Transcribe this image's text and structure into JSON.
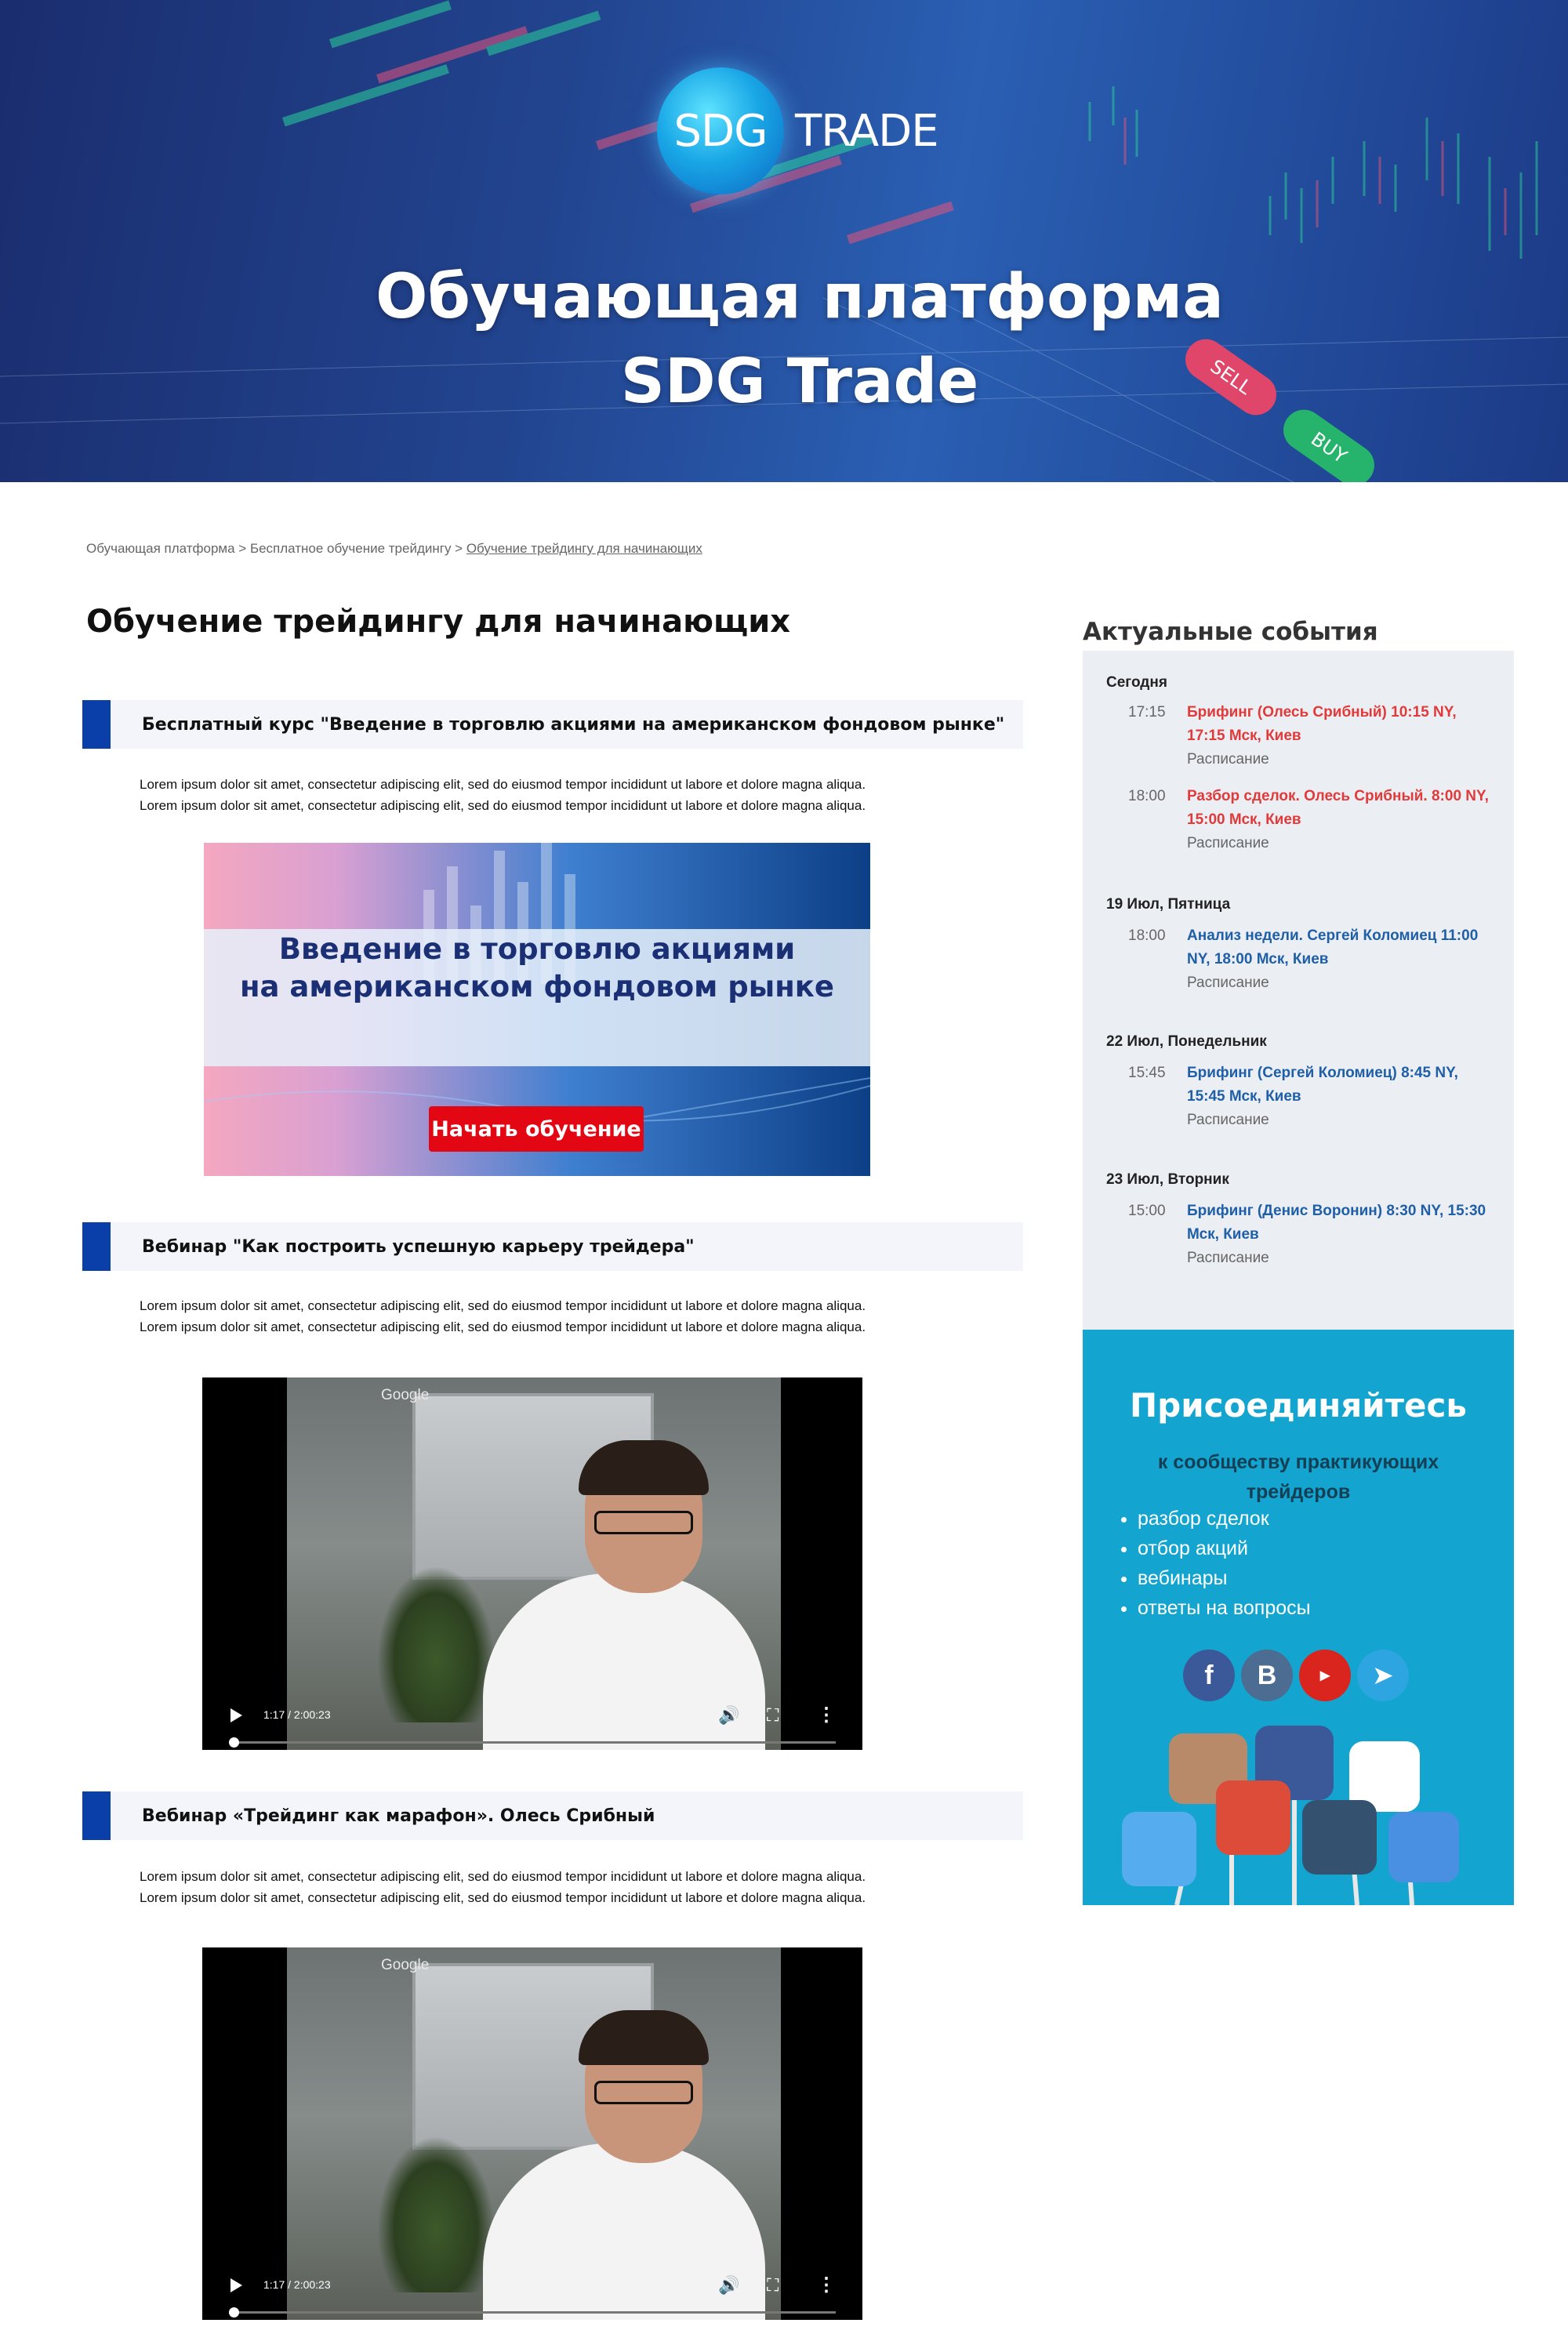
{
  "hero": {
    "logo_sdg": "SDG",
    "logo_trade": "TRADE",
    "title_line1": "Обучающая платформа",
    "title_line2": "SDG Trade",
    "sell_label": "SELL",
    "buy_label": "BUY"
  },
  "breadcrumb": {
    "item1": "Обучающая платформа",
    "sep1": " > ",
    "item2": "Бесплатное обучение трейдингу",
    "sep2": "  > ",
    "item3": "Обучение трейдингу для начинающих"
  },
  "main": {
    "title": "Обучение трейдингу для начинающих",
    "sections": [
      {
        "heading": "Бесплатный курс \"Введение в торговлю акциями на американском фондовом рынке\"",
        "text_line1": "Lorem ipsum dolor sit amet, consectetur adipiscing elit, sed do eiusmod tempor incididunt ut labore et dolore magna aliqua.",
        "text_line2": "Lorem ipsum dolor sit amet, consectetur adipiscing elit, sed do eiusmod tempor incididunt ut labore et dolore magna aliqua."
      },
      {
        "heading": "Вебинар \"Как построить успешную карьеру трейдера\"",
        "text_line1": "Lorem ipsum dolor sit amet, consectetur adipiscing elit, sed do eiusmod tempor incididunt ut labore et dolore magna aliqua.",
        "text_line2": "Lorem ipsum dolor sit amet, consectetur adipiscing elit, sed do eiusmod tempor incididunt ut labore et dolore magna aliqua."
      },
      {
        "heading": "Вебинар «Трейдинг как марафон». Олесь Срибный",
        "text_line1": "Lorem ipsum dolor sit amet, consectetur adipiscing elit, sed do eiusmod tempor incididunt ut labore et dolore magna aliqua.",
        "text_line2": "Lorem ipsum dolor sit amet, consectetur adipiscing elit, sed do eiusmod tempor incididunt ut labore et dolore magna aliqua."
      }
    ],
    "banner": {
      "line1": "Введение в торговлю акциями",
      "line2": "на американском фондовом рынке",
      "button": "Начать обучение"
    },
    "video": {
      "label": "Google",
      "time": "1:17 / 2:00:23"
    }
  },
  "sidebar": {
    "events_title": "Актуальные события",
    "schedule_label": "Расписание",
    "days": [
      {
        "day": "Сегодня",
        "events": [
          {
            "time": "17:15",
            "title": "Брифинг (Олесь Срибный) 10:15 NY, 17:15 Мск, Киев",
            "color": "#e03a3a"
          },
          {
            "time": "18:00",
            "title": "Разбор сделок. Олесь Срибный. 8:00 NY, 15:00 Мск, Киев",
            "color": "#e03a3a"
          }
        ]
      },
      {
        "day": "19 Июл, Пятница",
        "events": [
          {
            "time": "18:00",
            "title": "Анализ недели. Сергей Коломиец 11:00 NY, 18:00 Мск, Киев",
            "color": "#1f5fa8"
          }
        ]
      },
      {
        "day": "22 Июл, Понедельник",
        "events": [
          {
            "time": "15:45",
            "title": "Брифинг (Сергей Коломиец) 8:45 NY, 15:45 Мск, Киев",
            "color": "#1f5fa8"
          }
        ]
      },
      {
        "day": "23 Июл, Вторник",
        "events": [
          {
            "time": "15:00",
            "title": "Брифинг (Денис Воронин) 8:30 NY, 15:30 Мск, Киев",
            "color": "#1f5fa8"
          }
        ]
      }
    ],
    "join": {
      "title": "Присоединяйтесь",
      "subtitle": "к сообществу практикующих трейдеров",
      "items": [
        "разбор сделок",
        "отбор акций",
        "вебинары",
        "ответы на вопросы"
      ],
      "social": [
        "facebook-icon",
        "vk-icon",
        "youtube-icon",
        "telegram-icon"
      ]
    }
  }
}
